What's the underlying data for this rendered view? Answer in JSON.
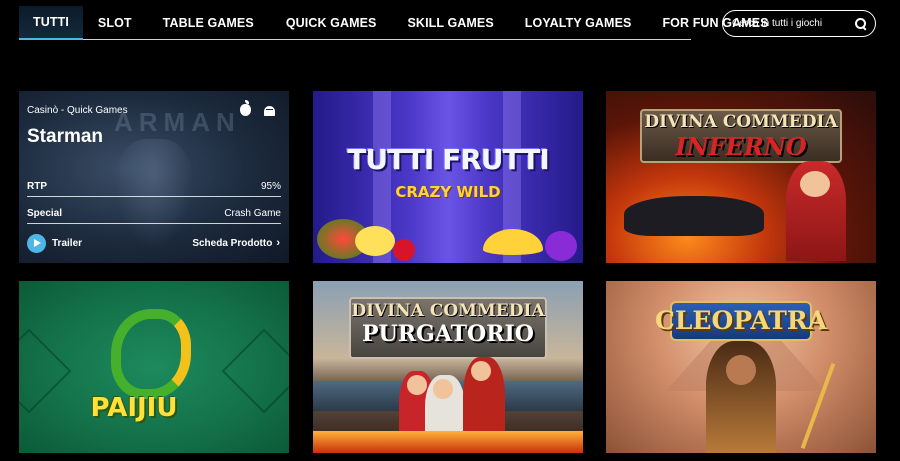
{
  "nav": {
    "tabs": [
      "TUTTI",
      "SLOT",
      "TABLE GAMES",
      "QUICK GAMES",
      "SKILL GAMES",
      "LOYALTY GAMES",
      "FOR FUN GAMES"
    ],
    "active_index": 0,
    "accent": "#4fb6e8"
  },
  "search": {
    "placeholder": "Cerca in tutti i giochi",
    "icon": "search-icon"
  },
  "featured": {
    "category": "Casinò - Quick Games",
    "title": "Starman",
    "background_word": "ARMAN",
    "platform_icons": [
      "apple-icon",
      "android-icon"
    ],
    "rows": [
      {
        "key": "RTP",
        "value": "95%"
      },
      {
        "key": "Special",
        "value": "Crash Game"
      }
    ],
    "trailer_label": "Trailer",
    "product_label": "Scheda Prodotto"
  },
  "games": [
    {
      "title": "TUTTI FRUTTI",
      "subtitle": "CRAZY WILD"
    },
    {
      "title": "DIVINA COMMEDIA",
      "subtitle": "INFERNO"
    },
    {
      "title": "PAIJIU",
      "subtitle": ""
    },
    {
      "title": "DIVINA COMMEDIA",
      "subtitle": "PURGATORIO"
    },
    {
      "title": "CLEOPATRA",
      "subtitle": ""
    }
  ]
}
